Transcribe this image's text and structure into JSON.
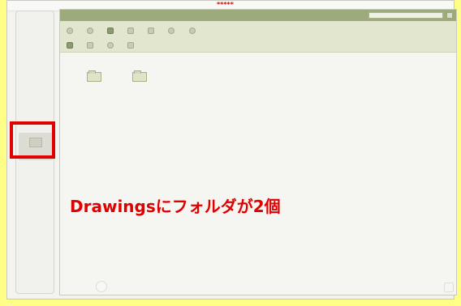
{
  "top_bar": {
    "stars": "*****"
  },
  "overlay": {
    "text": "Drawingsにフォルダが2個"
  }
}
